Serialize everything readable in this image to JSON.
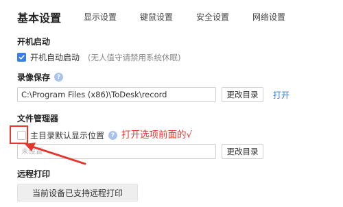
{
  "tabs": [
    {
      "label": "基本设置",
      "active": true
    },
    {
      "label": "显示设置",
      "active": false
    },
    {
      "label": "键鼠设置",
      "active": false
    },
    {
      "label": "安全设置",
      "active": false
    },
    {
      "label": "网络设置",
      "active": false
    }
  ],
  "startup": {
    "heading": "开机启动",
    "checkbox_label": "开机自动启动",
    "checked": true,
    "hint": "(无人值守请禁用系统休眠)"
  },
  "recording": {
    "heading": "录像保存",
    "path_value": "C:\\Program Files (x86)\\ToDesk\\record",
    "change_dir_label": "更改目录",
    "open_label": "打开"
  },
  "file_manager": {
    "heading": "文件管理器",
    "checkbox_label": "主目录默认显示位置",
    "checked": false,
    "input_placeholder": "未设置",
    "change_dir_label": "更改目录"
  },
  "annotation": {
    "text": "打开选项前面的√",
    "color": "#e2362f"
  },
  "remote_print": {
    "heading": "远程打印",
    "button_label": "当前设备已支持远程打印"
  },
  "colors": {
    "accent": "#3a7ee8",
    "link": "#2f7de1",
    "help_icon": "#a8c4ec"
  }
}
